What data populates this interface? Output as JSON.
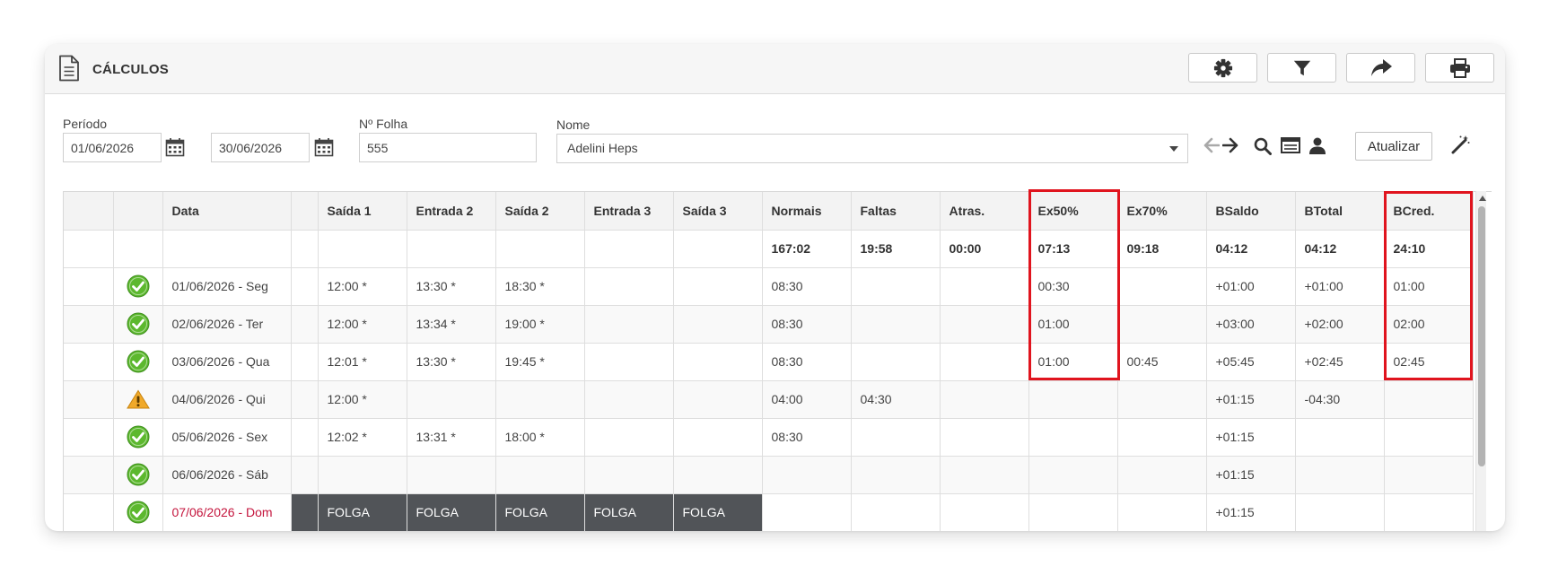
{
  "header": {
    "title": "CÁLCULOS"
  },
  "filters": {
    "periodo_label": "Período",
    "date_start": "01/06/2026",
    "date_end": "30/06/2026",
    "folha_label": "Nº Folha",
    "folha_value": "555",
    "nome_label": "Nome",
    "nome_value": "Adelini Heps",
    "update_label": "Atualizar"
  },
  "table": {
    "columns": [
      "",
      "",
      "Data",
      "",
      "Saída 1",
      "Entrada 2",
      "Saída 2",
      "Entrada 3",
      "Saída 3",
      "Normais",
      "Faltas",
      "Atras.",
      "Ex50%",
      "Ex70%",
      "BSaldo",
      "BTotal",
      "BCred."
    ],
    "totals": [
      "",
      "",
      "",
      "",
      "",
      "",
      "",
      "",
      "",
      "167:02",
      "19:58",
      "00:00",
      "07:13",
      "09:18",
      "04:12",
      "04:12",
      "24:10"
    ],
    "rows": [
      {
        "status": "ok",
        "weekend": false,
        "folga": false,
        "cells": [
          "",
          "",
          "01/06/2026 - Seg",
          "",
          "12:00 *",
          "13:30 *",
          "18:30 *",
          "",
          "",
          "08:30",
          "",
          "",
          "00:30",
          "",
          "+01:00",
          "+01:00",
          "01:00"
        ]
      },
      {
        "status": "ok",
        "weekend": false,
        "folga": false,
        "cells": [
          "",
          "",
          "02/06/2026 - Ter",
          "",
          "12:00 *",
          "13:34 *",
          "19:00 *",
          "",
          "",
          "08:30",
          "",
          "",
          "01:00",
          "",
          "+03:00",
          "+02:00",
          "02:00"
        ]
      },
      {
        "status": "ok",
        "weekend": false,
        "folga": false,
        "cells": [
          "",
          "",
          "03/06/2026 - Qua",
          "",
          "12:01 *",
          "13:30 *",
          "19:45 *",
          "",
          "",
          "08:30",
          "",
          "",
          "01:00",
          "00:45",
          "+05:45",
          "+02:45",
          "02:45"
        ]
      },
      {
        "status": "warn",
        "weekend": false,
        "folga": false,
        "cells": [
          "",
          "",
          "04/06/2026 - Qui",
          "",
          "12:00 *",
          "",
          "",
          "",
          "",
          "04:00",
          "04:30",
          "",
          "",
          "",
          "+01:15",
          "-04:30",
          ""
        ]
      },
      {
        "status": "ok",
        "weekend": false,
        "folga": false,
        "cells": [
          "",
          "",
          "05/06/2026 - Sex",
          "",
          "12:02 *",
          "13:31 *",
          "18:00 *",
          "",
          "",
          "08:30",
          "",
          "",
          "",
          "",
          "+01:15",
          "",
          ""
        ]
      },
      {
        "status": "ok",
        "weekend": false,
        "folga": false,
        "cells": [
          "",
          "",
          "06/06/2026 - Sáb",
          "",
          "",
          "",
          "",
          "",
          "",
          "",
          "",
          "",
          "",
          "",
          "+01:15",
          "",
          ""
        ]
      },
      {
        "status": "ok",
        "weekend": true,
        "folga": true,
        "cells": [
          "",
          "",
          "07/06/2026 - Dom",
          "",
          "FOLGA",
          "FOLGA",
          "FOLGA",
          "FOLGA",
          "FOLGA",
          "",
          "",
          "",
          "",
          "",
          "+01:15",
          "",
          ""
        ]
      }
    ]
  },
  "colors": {
    "highlight": "#e0141e",
    "folga_bg": "#515458",
    "weekend_text": "#c4143c",
    "status_ok": "#5cb82e",
    "status_warn": "#f0a92a"
  },
  "icons": {
    "header": "document-icon",
    "toolbar": [
      "gear-icon",
      "filter-icon",
      "share-arrow-icon",
      "print-icon"
    ],
    "actions": [
      "prev-arrow-icon",
      "next-arrow-icon",
      "search-icon",
      "list-icon",
      "user-icon",
      "magic-wand-icon"
    ]
  }
}
